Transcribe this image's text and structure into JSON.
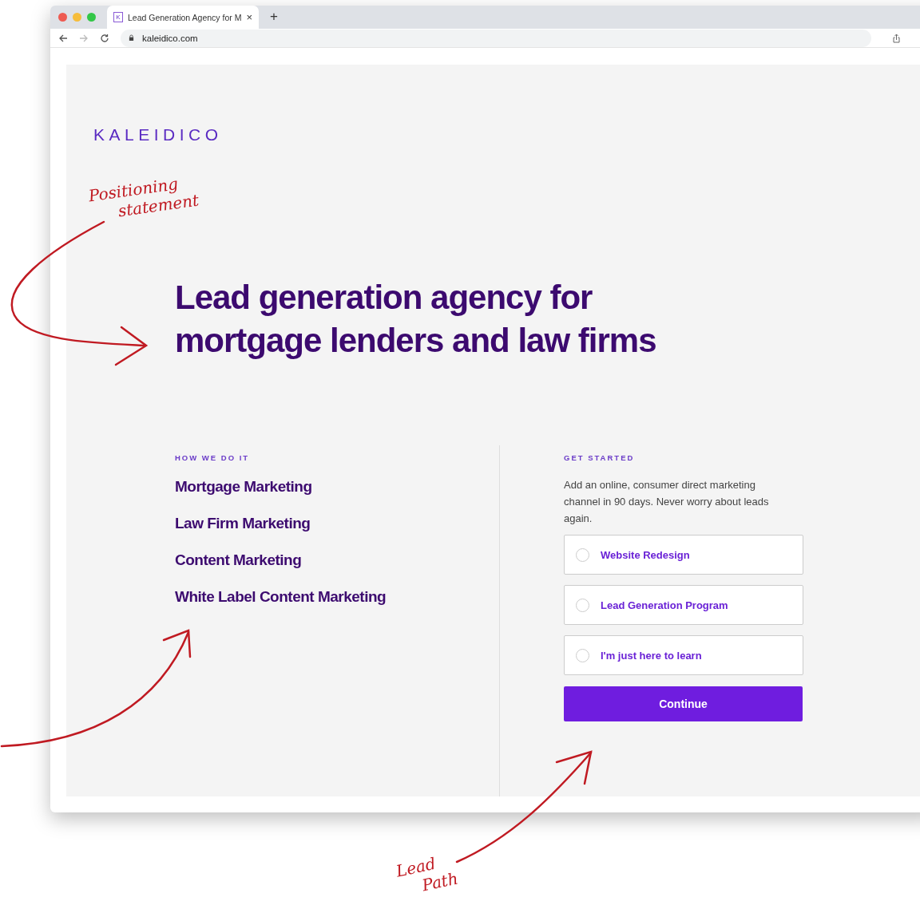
{
  "browser": {
    "tab": {
      "favicon": "K",
      "title": "Lead Generation Agency for M",
      "close": "×"
    },
    "new_tab": "+",
    "url": "kaleidico.com"
  },
  "page": {
    "logo": "KALEIDICO",
    "headline": [
      "Lead generation agency for",
      "mortgage lenders and law firms"
    ],
    "services": {
      "heading": "HOW WE DO IT",
      "items": [
        "Mortgage Marketing",
        "Law Firm Marketing",
        "Content Marketing",
        "White Label Content Marketing"
      ]
    },
    "get_started": {
      "heading": "GET STARTED",
      "description": "Add an online, consumer direct marketing channel in 90 days. Never worry about leads again.",
      "options": [
        {
          "label": "Website Redesign",
          "selected": false
        },
        {
          "label": "Lead Generation Program",
          "selected": false
        },
        {
          "label": "I'm just here to learn",
          "selected": false
        }
      ],
      "button": "Continue"
    }
  },
  "annotations": [
    {
      "lines": [
        "Positioning",
        "statement"
      ]
    },
    {
      "lines": [
        "Lead",
        "Path"
      ]
    }
  ]
}
